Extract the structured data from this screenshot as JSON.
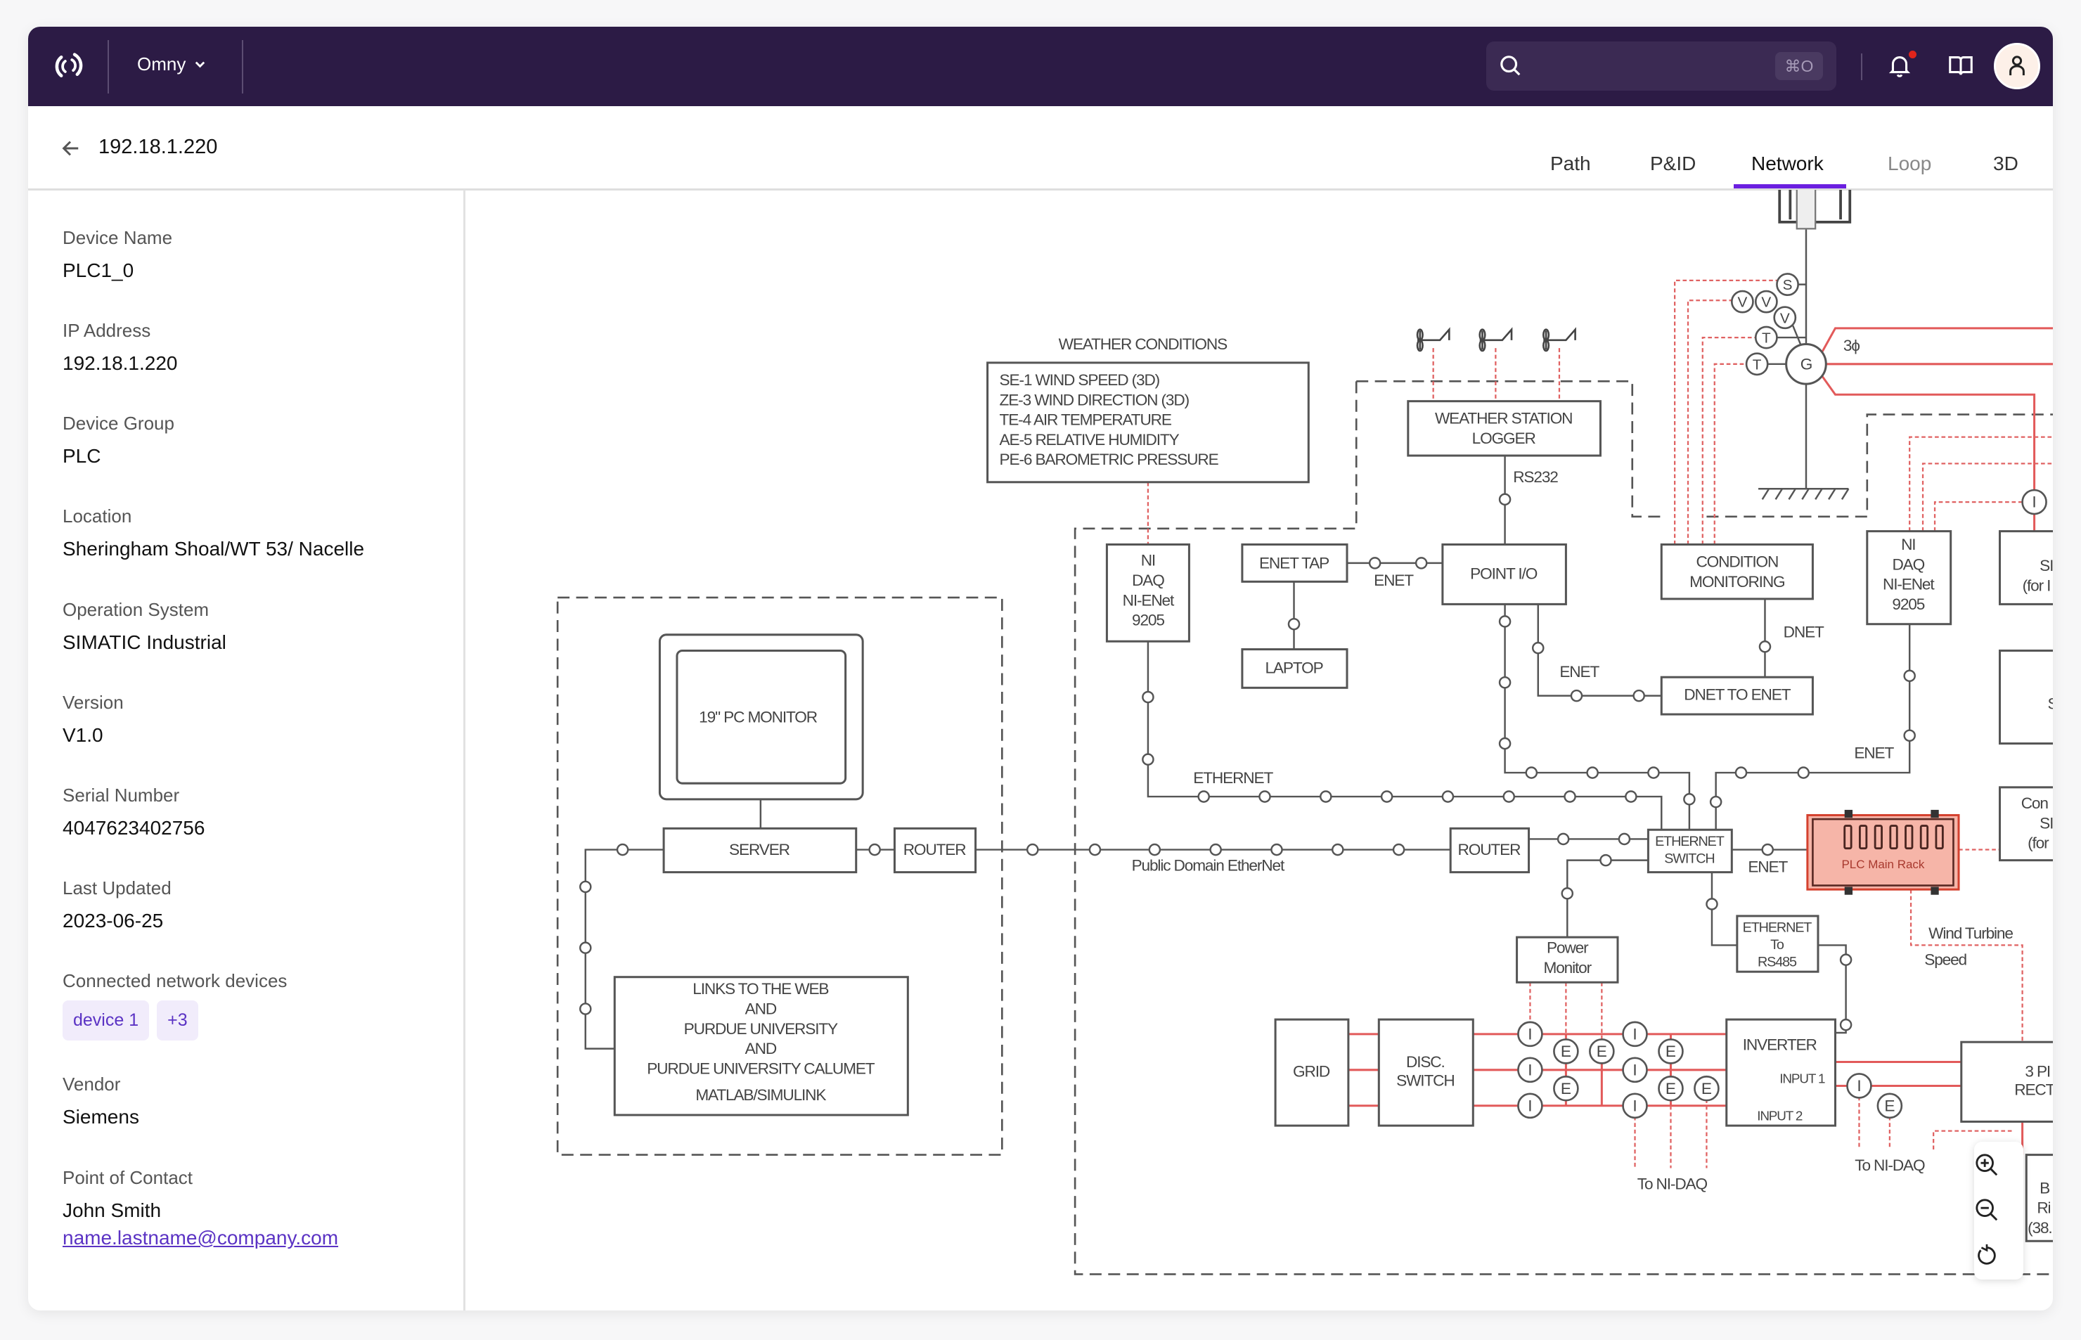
{
  "app": {
    "name": "Omny"
  },
  "header": {
    "search_value": "",
    "shortcut": "⌘O",
    "has_notification": true
  },
  "page": {
    "title": "192.18.1.220"
  },
  "tabs": [
    {
      "label": "Path"
    },
    {
      "label": "P&ID"
    },
    {
      "label": "Network",
      "active": true
    },
    {
      "label": "Loop"
    },
    {
      "label": "3D"
    }
  ],
  "details": {
    "device_name": {
      "label": "Device Name",
      "value": "PLC1_0"
    },
    "ip_address": {
      "label": "IP Address",
      "value": "192.18.1.220"
    },
    "device_group": {
      "label": "Device Group",
      "value": "PLC"
    },
    "location": {
      "label": "Location",
      "value": "Sheringham Shoal/WT 53/ Nacelle"
    },
    "os": {
      "label": "Operation System",
      "value": "SIMATIC Industrial"
    },
    "version": {
      "label": "Version",
      "value": "V1.0"
    },
    "serial": {
      "label": "Serial Number",
      "value": "4047623402756"
    },
    "updated": {
      "label": "Last Updated",
      "value": "2023-06-25"
    },
    "connected": {
      "label": "Connected network devices",
      "chips": [
        "device 1",
        "+3"
      ]
    },
    "vendor": {
      "label": "Vendor",
      "value": "Siemens"
    },
    "contact": {
      "label": "Point of Contact",
      "name": "John Smith",
      "email": "name.lastname@company.com"
    }
  },
  "diagram": {
    "weather_title": "WEATHER CONDITIONS",
    "weather_items": [
      "SE-1 WIND SPEED (3D)",
      "ZE-3 WIND DIRECTION (3D)",
      "TE-4 AIR TEMPERATURE",
      "AE-5 RELATIVE HUMIDITY",
      "PE-6 BAROMETRIC PRESSURE"
    ],
    "ws_logger": [
      "WEATHER STATION",
      "LOGGER"
    ],
    "rs232": "RS232",
    "ni_daq_1": [
      "NI",
      "DAQ",
      "NI-ENet",
      "9205"
    ],
    "enet_tap": "ENET TAP",
    "enet_1": "ENET",
    "laptop": "LAPTOP",
    "point_io": "POINT I/O",
    "condition_monitoring": [
      "CONDITION",
      "MONITORING"
    ],
    "dnet": "DNET",
    "enet_2": "ENET",
    "dnet_to_enet": "DNET TO ENET",
    "ni_daq_2": [
      "NI",
      "DAQ",
      "NI-ENet",
      "9205"
    ],
    "enet_3": "ENET",
    "si_box": [
      "SI",
      "(for I"
    ],
    "s_box": "S",
    "con_box": [
      "Con",
      "SI",
      "(for"
    ],
    "ethernet": "ETHERNET",
    "monitor": "19\" PC MONITOR",
    "server": "SERVER",
    "router_1": "ROUTER",
    "public_net": "Public Domain EtherNet",
    "router_2": "ROUTER",
    "eth_switch": [
      "ETHERNET",
      "SWITCH"
    ],
    "enet_4": "ENET",
    "plc_rack": "PLC Main Rack",
    "power_monitor": [
      "Power",
      "Monitor"
    ],
    "eth_rs485": [
      "ETHERNET",
      "To",
      "RS485"
    ],
    "wind_speed": [
      "Wind Turbine",
      "Speed"
    ],
    "grid": "GRID",
    "disc_switch": [
      "DISC.",
      "SWITCH"
    ],
    "inverter": "INVERTER",
    "input_1": "INPUT 1",
    "input_2": "INPUT 2",
    "to_nidaq_1": "To NI-DAQ",
    "to_nidaq_2": "To NI-DAQ",
    "rect_box": [
      "3 PI",
      "RECT"
    ],
    "b_box": [
      "B",
      "Ri",
      "(38."
    ],
    "links": [
      "LINKS TO THE WEB",
      "AND",
      "PURDUE UNIVERSITY",
      "AND",
      "PURDUE UNIVERSITY CALUMET",
      "MATLAB/SIMULINK"
    ],
    "three_phase": "3ϕ",
    "generator": "G",
    "sensor_s": "S",
    "sensor_v": "V",
    "sensor_t": "T",
    "meter_i": "I",
    "meter_e": "E"
  },
  "colors": {
    "topbar": "#2c1b45",
    "accent": "#6b1fe0",
    "chip_bg": "#f1ecfb",
    "link": "#5b33c4",
    "power_line": "#e25a5a",
    "plc_highlight": "#f6b5a8"
  }
}
